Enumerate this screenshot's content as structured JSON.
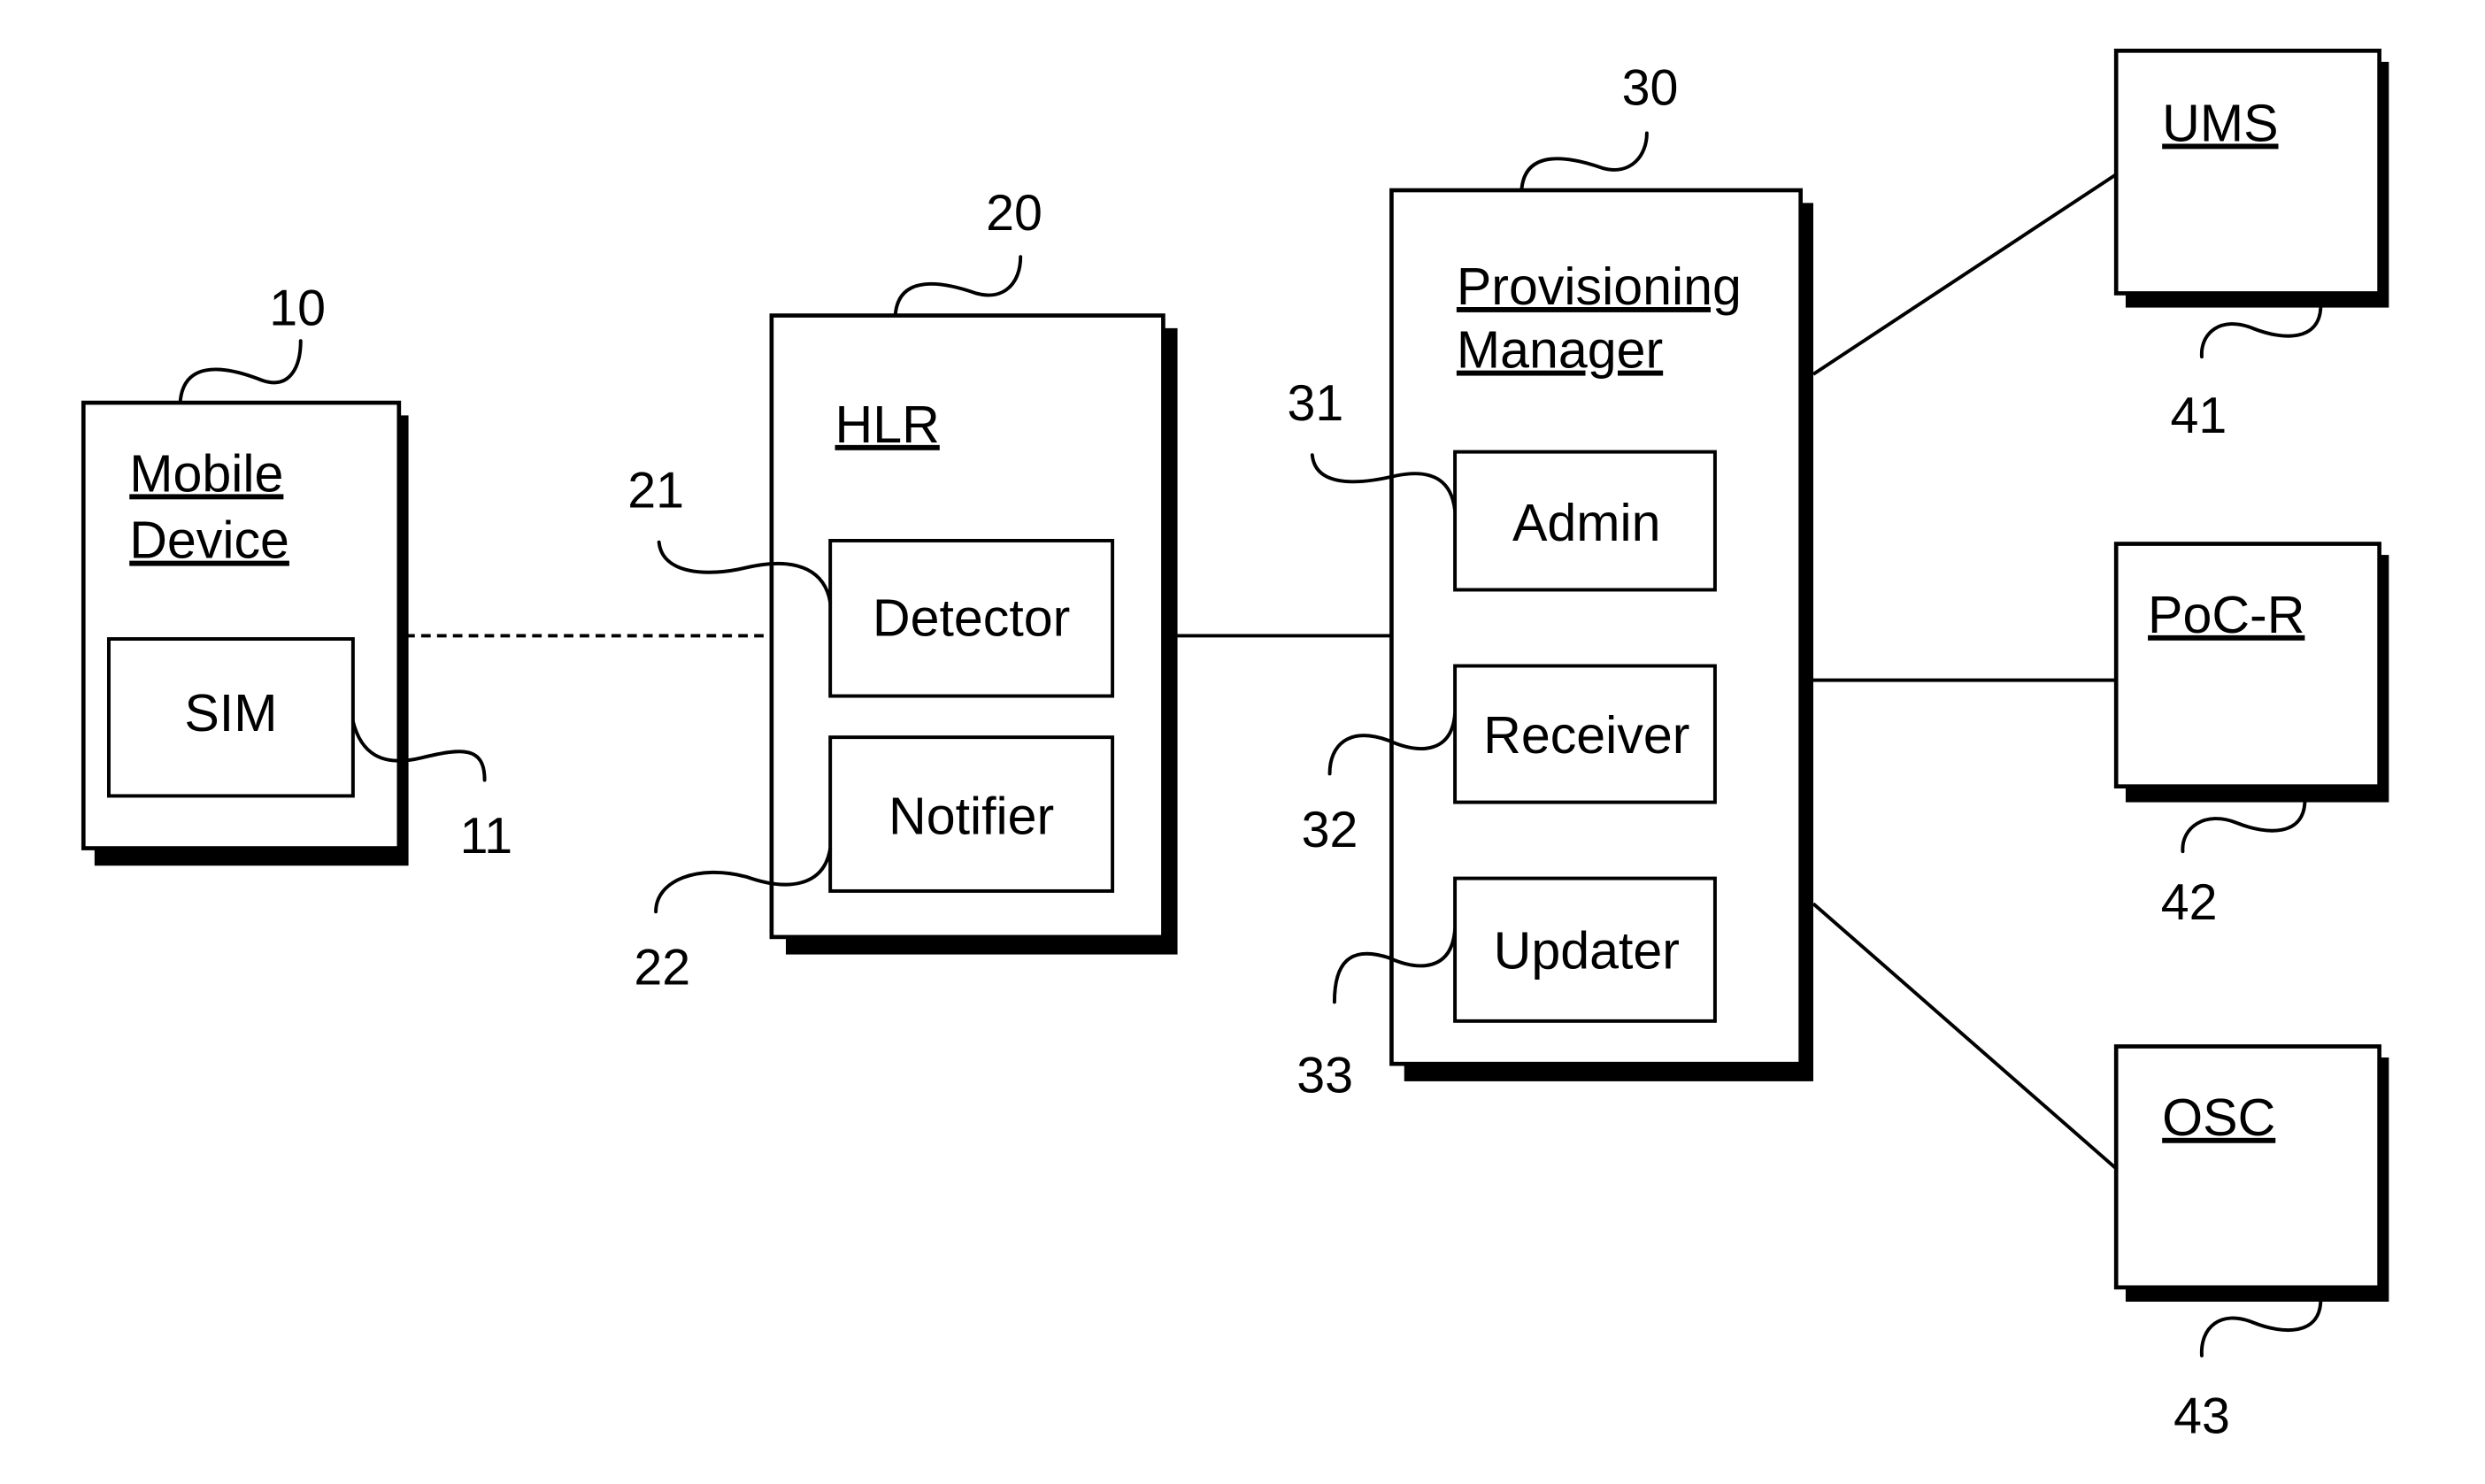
{
  "diagram": {
    "nodes": {
      "mobile_device": {
        "title_line1": "Mobile",
        "title_line2": "Device",
        "ref": "10",
        "components": {
          "sim": {
            "label": "SIM",
            "ref": "11"
          }
        }
      },
      "hlr": {
        "title": "HLR",
        "ref": "20",
        "components": {
          "detector": {
            "label": "Detector",
            "ref": "21"
          },
          "notifier": {
            "label": "Notifier",
            "ref": "22"
          }
        }
      },
      "provisioning_manager": {
        "title_line1": "Provisioning",
        "title_line2": "Manager",
        "ref": "30",
        "components": {
          "admin": {
            "label": "Admin",
            "ref": "31"
          },
          "receiver": {
            "label": "Receiver",
            "ref": "32"
          },
          "updater": {
            "label": "Updater",
            "ref": "33"
          }
        }
      },
      "ums": {
        "title": "UMS",
        "ref": "41"
      },
      "poc_r": {
        "title": "PoC-R",
        "ref": "42"
      },
      "osc": {
        "title": "OSC",
        "ref": "43"
      }
    },
    "edges": [
      {
        "from": "mobile_device",
        "to": "hlr",
        "style": "dashed"
      },
      {
        "from": "hlr",
        "to": "provisioning_manager",
        "style": "solid"
      },
      {
        "from": "provisioning_manager",
        "to": "ums",
        "style": "solid"
      },
      {
        "from": "provisioning_manager",
        "to": "poc_r",
        "style": "solid"
      },
      {
        "from": "provisioning_manager",
        "to": "osc",
        "style": "solid"
      }
    ]
  }
}
